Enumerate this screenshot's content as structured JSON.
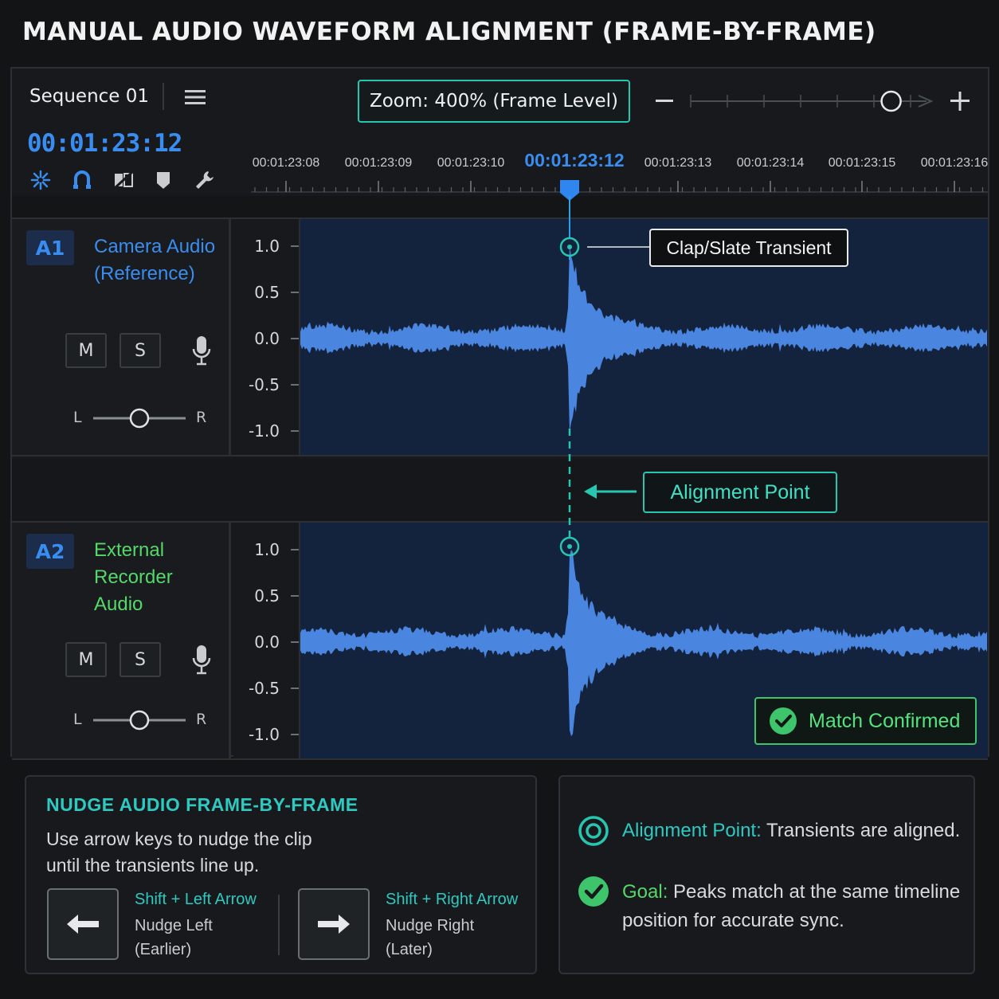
{
  "page_title": "MANUAL AUDIO WAVEFORM ALIGNMENT (FRAME-BY-FRAME)",
  "header": {
    "sequence_name": "Sequence 01",
    "timecode": "00:01:23:12",
    "zoom_label": "Zoom: 400% (Frame Level)",
    "zoom_minus": "−",
    "zoom_plus": "+",
    "zoom_level": 0.85,
    "tools": [
      "snap-icon",
      "magnet-icon",
      "linked-selection-icon",
      "marker-icon",
      "wrench-icon"
    ]
  },
  "ruler": {
    "labels": [
      "00:01:23:08",
      "00:01:23:09",
      "00:01:23:10",
      "00:01:23:12",
      "00:01:23:13",
      "00:01:23:14",
      "00:01:23:15",
      "00:01:23:16"
    ],
    "active_label": "00:01:23:12"
  },
  "tracks": [
    {
      "id": "A1",
      "name": "Camera Audio (Reference)",
      "name_color": "#3a8df0",
      "mute": "M",
      "solo": "S",
      "pan_left": "L",
      "pan_right": "R",
      "pan": 0.5,
      "axis_labels": [
        "1.0",
        "0.5",
        "0.0",
        "-0.5",
        "-1.0"
      ]
    },
    {
      "id": "A2",
      "name": "External Recorder Audio",
      "name_color": "#54d86a",
      "mute": "M",
      "solo": "S",
      "pan_left": "L",
      "pan_right": "R",
      "pan": 0.5,
      "axis_labels": [
        "1.0",
        "0.5",
        "0.0",
        "-0.5",
        "-1.0"
      ]
    }
  ],
  "callouts": {
    "transient": "Clap/Slate Transient",
    "alignment_point": "Alignment Point",
    "match": "Match Confirmed"
  },
  "nudge_panel": {
    "title": "NUDGE AUDIO FRAME-BY-FRAME",
    "description": "Use arrow keys to nudge the clip until the transients line up.",
    "left_combo": "Shift + Left Arrow",
    "left_action": "Nudge Left",
    "left_detail": "(Earlier)",
    "right_combo": "Shift + Right Arrow",
    "right_action": "Nudge Right",
    "right_detail": "(Later)"
  },
  "info_panel": {
    "alignment_key": "Alignment Point:",
    "alignment_text": "Transients are aligned.",
    "goal_key": "Goal:",
    "goal_text": "Peaks match at the same timeline position for accurate sync."
  },
  "colors": {
    "accent_blue": "#3a8df0",
    "accent_teal": "#26c6b0",
    "accent_green": "#3ec46a",
    "waveform": "#4a86e0",
    "waveform_bg": "#13233d"
  }
}
